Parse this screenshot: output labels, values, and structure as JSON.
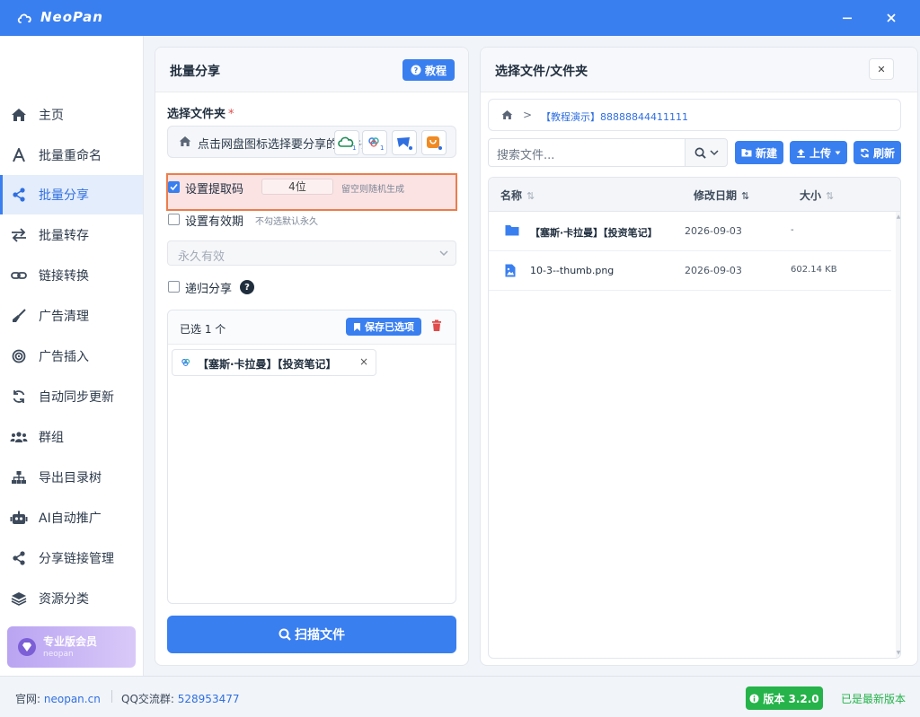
{
  "app": {
    "title": "NeoPan"
  },
  "sidebar": {
    "items": [
      {
        "label": "主页",
        "icon": "home-icon"
      },
      {
        "label": "批量重命名",
        "icon": "font-icon"
      },
      {
        "label": "批量分享",
        "icon": "share-icon",
        "active": true
      },
      {
        "label": "批量转存",
        "icon": "exchange-icon"
      },
      {
        "label": "链接转换",
        "icon": "link-icon"
      },
      {
        "label": "广告清理",
        "icon": "broom-icon"
      },
      {
        "label": "广告插入",
        "icon": "target-icon"
      },
      {
        "label": "自动同步更新",
        "icon": "sync-icon"
      },
      {
        "label": "群组",
        "icon": "users-icon"
      },
      {
        "label": "导出目录树",
        "icon": "sitemap-icon"
      },
      {
        "label": "AI自动推广",
        "icon": "robot-icon"
      },
      {
        "label": "分享链接管理",
        "icon": "share-alt-icon"
      },
      {
        "label": "资源分类",
        "icon": "layers-icon"
      }
    ],
    "vip": {
      "title": "专业版会员",
      "subtitle": "neopan"
    }
  },
  "share_panel": {
    "title": "批量分享",
    "tutorial_label": "教程",
    "folder_label": "选择文件夹",
    "required_mark": "*",
    "folder_placeholder": "点击网盘图标选择要分享的文件夹",
    "disk_buttons": [
      "cloud-drive-1-icon",
      "baidu-drive-icon",
      "tianyi-drive-icon",
      "uc-drive-icon"
    ],
    "disk_badges": [
      "1",
      "1",
      "",
      ""
    ],
    "extract_code": {
      "label": "设置提取码",
      "checked": true,
      "value": "4位",
      "hint": "留空则随机生成"
    },
    "expiry": {
      "label": "设置有效期",
      "checked": false,
      "hint": "不勾选默认永久",
      "selected": "永久有效"
    },
    "recursive": {
      "label": "递归分享",
      "checked": false,
      "help": "?"
    },
    "selected": {
      "count_label": "已选 1 个",
      "save_label": "保存已选项",
      "chips": [
        {
          "label": "【塞斯·卡拉曼】【投资笔记】",
          "remove": "×"
        }
      ]
    },
    "scan_label": "扫描文件"
  },
  "file_panel": {
    "title": "选择文件/文件夹",
    "close": "✕",
    "breadcrumb": {
      "sep": ">",
      "path": "【教程演示】88888844411111"
    },
    "search_placeholder": "搜索文件...",
    "buttons": {
      "new": "新建",
      "upload": "上传",
      "refresh": "刷新"
    },
    "columns": {
      "name": "名称",
      "modified": "修改日期",
      "size": "大小",
      "sort_idle": "⇅",
      "sort_active": "⇅"
    },
    "rows": [
      {
        "type": "folder",
        "name": "【塞斯·卡拉曼】【投资笔记】",
        "date": "2026-09-03",
        "size": "-"
      },
      {
        "type": "image",
        "name": "10-3--thumb.png",
        "date": "2026-09-03",
        "size": "602.14 KB"
      }
    ]
  },
  "footer": {
    "site_label": "官网:",
    "site": "neopan.cn",
    "qq_label": "QQ交流群:",
    "qq": "528953477",
    "version": "版本 3.2.0",
    "status": "已是最新版本"
  },
  "colors": {
    "accent": "#3a7ff0",
    "success": "#25b34a",
    "danger": "#e04b4b",
    "highlight_border": "#ec7d4a"
  }
}
